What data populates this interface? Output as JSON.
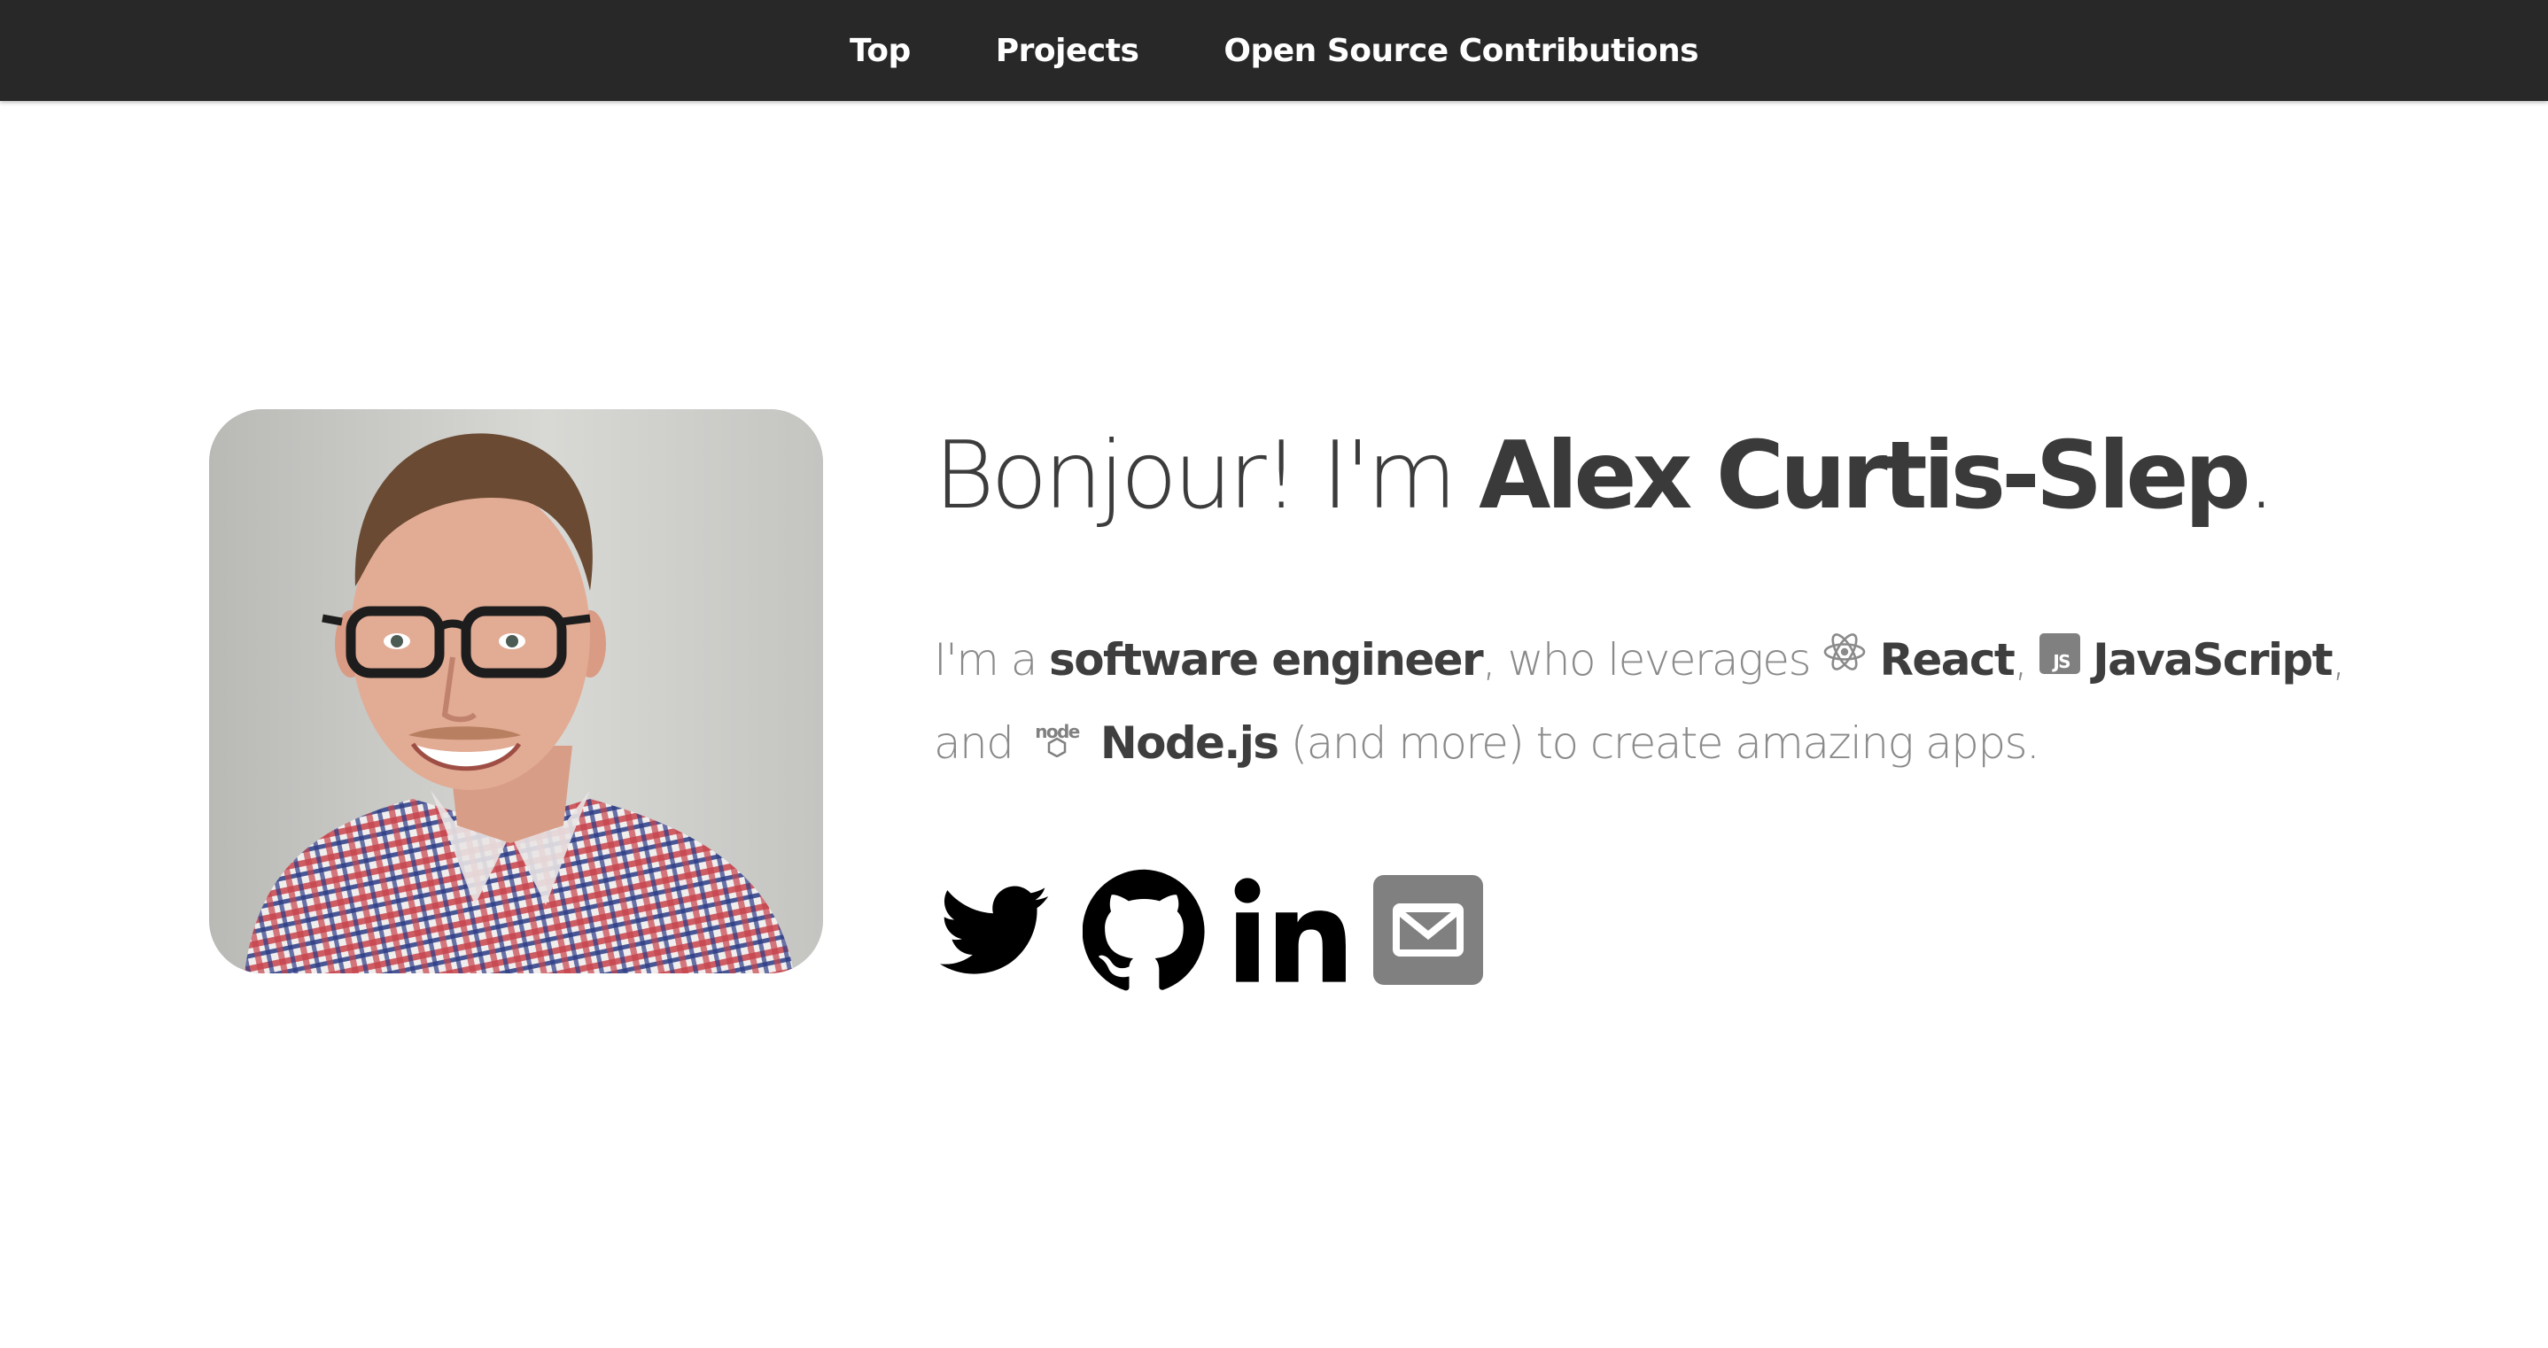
{
  "nav": {
    "items": [
      {
        "label": "Top"
      },
      {
        "label": "Projects"
      },
      {
        "label": "Open Source Contributions"
      }
    ]
  },
  "hero": {
    "greeting_prefix": "Bonjour! I'm ",
    "name": "Alex Curtis-Slep",
    "greeting_suffix": ".",
    "bio": {
      "t1": "I'm a ",
      "role": "software engineer",
      "t2": ", who leverages ",
      "tech1": "React",
      "sep1": ", ",
      "tech2": "JavaScript",
      "sep2": ",",
      "t3": " and ",
      "tech3": "Node.js",
      "t4": " (and more) to create amazing apps."
    },
    "js_badge_text": "JS",
    "node_logo_text": "node"
  },
  "social": [
    {
      "icon": "twitter-icon",
      "color": "#000000"
    },
    {
      "icon": "github-icon",
      "color": "#000000"
    },
    {
      "icon": "linkedin-icon",
      "color": "#000000"
    },
    {
      "icon": "email-icon",
      "color": "#808080"
    }
  ],
  "colors": {
    "navbar_bg": "#282828",
    "heading": "#3c3c3c",
    "body_text": "#8a8a8a",
    "icon_gray": "#808080"
  }
}
